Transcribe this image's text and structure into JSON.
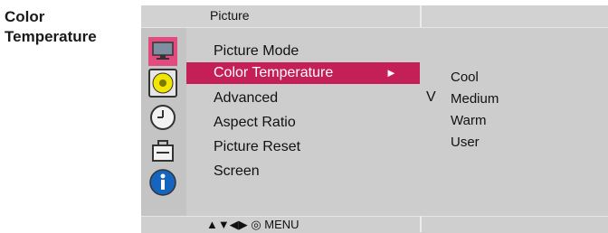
{
  "page": {
    "title_line1": "Color",
    "title_line2": "Temperature"
  },
  "osd": {
    "header_title": "Picture",
    "icons": [
      "picture-icon",
      "sound-icon",
      "time-icon",
      "option-icon",
      "information-icon"
    ],
    "menu_items": [
      {
        "label": "Picture Mode"
      },
      {
        "label": "Color Temperature",
        "arrow": "►"
      },
      {
        "label": "Advanced"
      },
      {
        "label": "Aspect Ratio"
      },
      {
        "label": "Picture Reset"
      },
      {
        "label": "Screen"
      }
    ],
    "submenu": {
      "items": [
        "Cool",
        "Medium",
        "Warm",
        "User"
      ],
      "check_mark": "V"
    },
    "footer": {
      "nav": "▲▼◀▶ ◎ MENU"
    },
    "colors": {
      "accent": "#c51f58",
      "panel": "#cdcdcd"
    }
  }
}
